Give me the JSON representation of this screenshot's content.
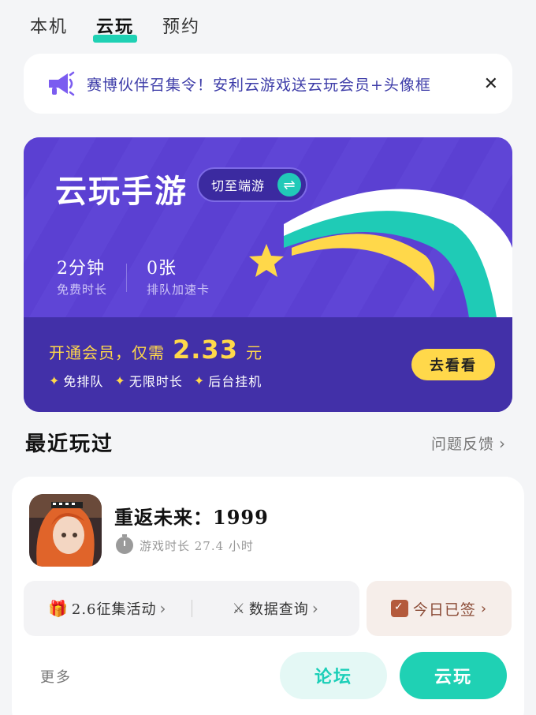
{
  "tabs": [
    {
      "label": "本机"
    },
    {
      "label": "云玩"
    },
    {
      "label": "预约"
    }
  ],
  "notice": {
    "text": "赛博伙伴召集令！安利云游戏送云玩会员+头像框",
    "icon": "megaphone-icon"
  },
  "banner": {
    "title": "云玩手游",
    "switch_label": "切至端游",
    "stats": [
      {
        "value": "2分钟",
        "label": "免费时长"
      },
      {
        "value": "0张",
        "label": "排队加速卡"
      }
    ],
    "promo_prefix": "开通会员，仅需",
    "promo_price": "2.33",
    "promo_unit": "元",
    "perks": [
      "免排队",
      "无限时长",
      "后台挂机"
    ],
    "cta": "去看看"
  },
  "recent": {
    "title": "最近玩过",
    "feedback": "问题反馈"
  },
  "game": {
    "name": "重返未来：1999",
    "playtime": "游戏时长 27.4 小时",
    "actions": [
      "2.6征集活动",
      "数据查询"
    ],
    "checkin": "今日已签",
    "more": "更多",
    "forum": "论坛",
    "play": "云玩"
  },
  "colors": {
    "accent": "#1fd1b4",
    "banner": "#5a3fd0",
    "promo": "#ffd84a"
  }
}
